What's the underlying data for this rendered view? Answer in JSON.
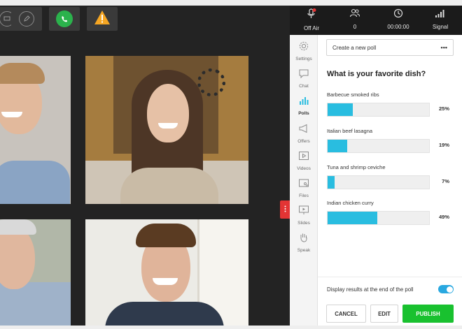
{
  "toolbar": {
    "buttons": [
      {
        "icon": "screen-share-icon"
      },
      {
        "icon": "pencil-icon"
      },
      {
        "icon": "phone-call-icon",
        "color": "#2bb24c"
      },
      {
        "icon": "warning-icon",
        "color": "#f5a623"
      }
    ]
  },
  "status": {
    "off_air": "Off Air",
    "participants": "0",
    "timer": "00:00:00",
    "signal": "Signal"
  },
  "nav": [
    {
      "label": "Settings",
      "icon": "gear-icon"
    },
    {
      "label": "Chat",
      "icon": "chat-icon"
    },
    {
      "label": "Polls",
      "icon": "bar-chart-icon"
    },
    {
      "label": "Offers",
      "icon": "megaphone-icon"
    },
    {
      "label": "Videos",
      "icon": "video-icon"
    },
    {
      "label": "Files",
      "icon": "files-icon"
    },
    {
      "label": "Slides",
      "icon": "slides-icon"
    },
    {
      "label": "Speak",
      "icon": "hand-icon"
    }
  ],
  "poll": {
    "create_label": "Create a new poll",
    "more": "•••",
    "question": "What is your favorite dish?",
    "options": [
      {
        "label": "Barbecue smoked ribs",
        "percent": "25%",
        "value": 25
      },
      {
        "label": "Italian beef lasagna",
        "percent": "19%",
        "value": 19
      },
      {
        "label": "Tuna and shrimp ceviche",
        "percent": "7%",
        "value": 7
      },
      {
        "label": "Indian chicken curry",
        "percent": "49%",
        "value": 49
      }
    ],
    "display_results_label": "Display results at the end of the poll",
    "display_results_on": true
  },
  "actions": {
    "cancel": "CANCEL",
    "edit": "EDIT",
    "publish": "PUBLISH"
  },
  "colors": {
    "accent": "#29bde0",
    "publish": "#19c12f",
    "alert": "#e33434"
  }
}
